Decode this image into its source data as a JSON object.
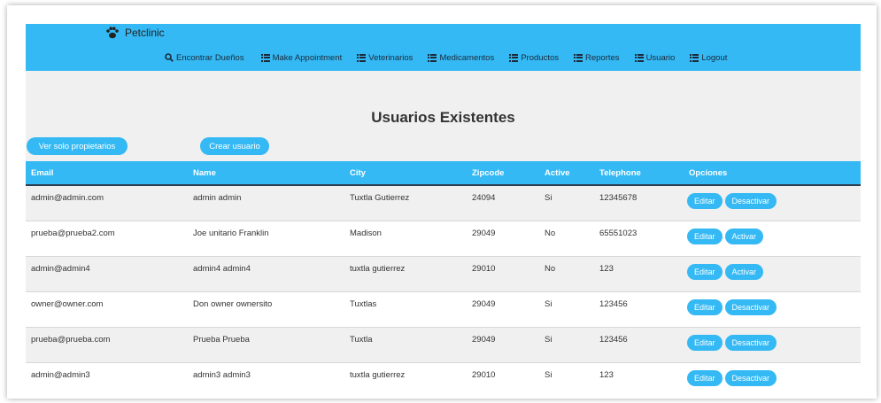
{
  "app": {
    "brand": "Petclinic"
  },
  "nav": [
    {
      "label": "Encontrar Dueños",
      "icon": "search-icon"
    },
    {
      "label": "Make Appointment",
      "icon": "list-icon"
    },
    {
      "label": "Veterinarios",
      "icon": "list-icon"
    },
    {
      "label": "Medicamentos",
      "icon": "list-icon"
    },
    {
      "label": "Productos",
      "icon": "list-icon"
    },
    {
      "label": "Reportes",
      "icon": "list-icon"
    },
    {
      "label": "Usuario",
      "icon": "list-icon"
    },
    {
      "label": "Logout",
      "icon": "list-icon"
    }
  ],
  "page": {
    "title": "Usuarios Existentes",
    "owners_button": "Ver solo propietarios",
    "create_button": "Crear usuario"
  },
  "table": {
    "headers": {
      "email": "Email",
      "name": "Name",
      "city": "City",
      "zipcode": "Zipcode",
      "active": "Active",
      "telephone": "Telephone",
      "options": "Opciones"
    },
    "rows": [
      {
        "email": "admin@admin.com",
        "name": "admin admin",
        "city": "Tuxtla Gutierrez",
        "zipcode": "24094",
        "active": "Si",
        "telephone": "12345678",
        "edit": "Editar",
        "toggle": "Desactivar"
      },
      {
        "email": "prueba@prueba2.com",
        "name": "Joe unitario Franklin",
        "city": "Madison",
        "zipcode": "29049",
        "active": "No",
        "telephone": "65551023",
        "edit": "Editar",
        "toggle": "Activar"
      },
      {
        "email": "admin@admin4",
        "name": "admin4 admin4",
        "city": "tuxtla gutierrez",
        "zipcode": "29010",
        "active": "No",
        "telephone": "123",
        "edit": "Editar",
        "toggle": "Activar"
      },
      {
        "email": "owner@owner.com",
        "name": "Don owner ownersito",
        "city": "Tuxtlas",
        "zipcode": "29049",
        "active": "Si",
        "telephone": "123456",
        "edit": "Editar",
        "toggle": "Desactivar"
      },
      {
        "email": "prueba@prueba.com",
        "name": "Prueba Prueba",
        "city": "Tuxtla",
        "zipcode": "29049",
        "active": "Si",
        "telephone": "123456",
        "edit": "Editar",
        "toggle": "Desactivar"
      },
      {
        "email": "admin@admin3",
        "name": "admin3 admin3",
        "city": "tuxtla gutierrez",
        "zipcode": "29010",
        "active": "Si",
        "telephone": "123",
        "edit": "Editar",
        "toggle": "Desactivar"
      }
    ]
  },
  "colors": {
    "accent": "#34b9f4",
    "background": "#f0f0f0"
  }
}
